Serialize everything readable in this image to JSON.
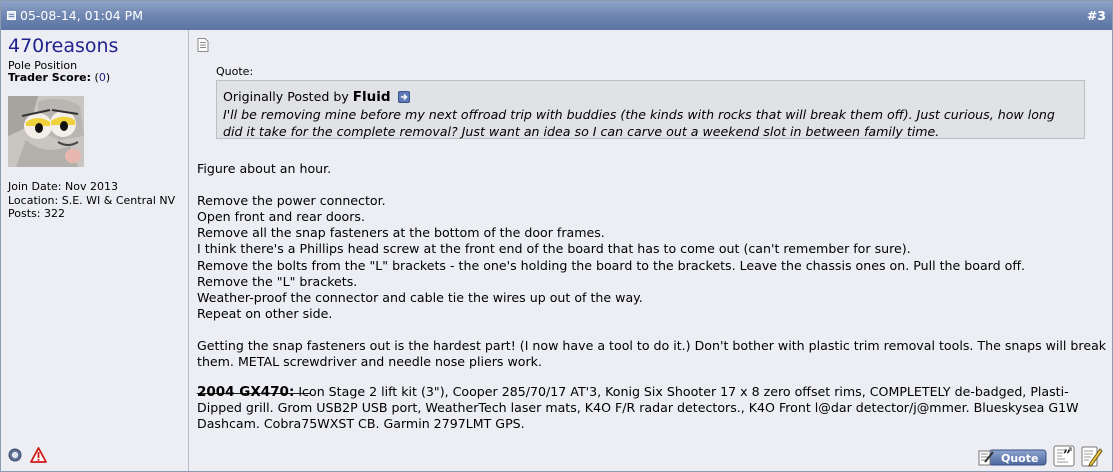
{
  "header": {
    "date": "05-08-14, 01:04 PM",
    "post_number": "#3",
    "post_icon": "post-status-icon"
  },
  "user": {
    "username": "470reasons",
    "title": "Pole Position",
    "trader_label": "Trader Score:",
    "trader_score_open": "(",
    "trader_score": "0",
    "trader_score_close": ")",
    "avatar": "avatar-image",
    "join_date": "Join Date: Nov 2013",
    "location": "Location: S.E. WI & Central NV",
    "posts": "Posts: 322",
    "online_icon": "offline-status-icon",
    "report_icon": "report-post-icon"
  },
  "quote": {
    "label": "Quote:",
    "posted_by": "Originally Posted by",
    "author": "Fluid",
    "text": "I'll be removing mine before my next offroad trip with buddies (the kinds with rocks that will break them off). Just curious, how long did it take for the complete removal? Just want an idea so I can carve out a weekend slot in between family time."
  },
  "message": {
    "line1": "Figure about an hour.",
    "steps": [
      "Remove the power connector.",
      "Open front and rear doors.",
      "Remove all the snap fasteners at the bottom of the door frames.",
      "I think there's a Phillips head screw at the front end of the board that has to come out (can't remember for sure).",
      "Remove the bolts from the \"L\" brackets - the one's holding the board to the brackets. Leave the chassis ones on. Pull the board off.",
      "Remove the \"L\" brackets.",
      "Weather-proof the connector and cable tie the wires up out of the way.",
      "Repeat on other side."
    ],
    "closing": "Getting the snap fasteners out is the hardest part! (I now have a tool to do it.) Don't bother with plastic trim removal tools. The snaps will break them. METAL screwdriver and needle nose pliers work."
  },
  "signature": {
    "separator": "__________________",
    "vehicle": "2004 GX470:",
    "text": " Icon Stage 2 lift kit (3\"), Cooper 285/70/17 AT'3, Konig Six Shooter 17 x 8 zero offset rims, COMPLETELY de-badged, Plasti-Dipped grill. Grom USB2P USB port, WeatherTech laser mats, K4O F/R radar detectors., K4O Front l@dar detector/j@mmer. Blueskysea G1W Dashcam. Cobra75WXST CB. Garmin 2797LMT GPS."
  },
  "buttons": {
    "quote": "Quote"
  },
  "colors": {
    "header_bg": "#6f86b1",
    "username": "#22228e",
    "post_bg": "#eceef3",
    "quote_bg": "#e1e2e6"
  }
}
